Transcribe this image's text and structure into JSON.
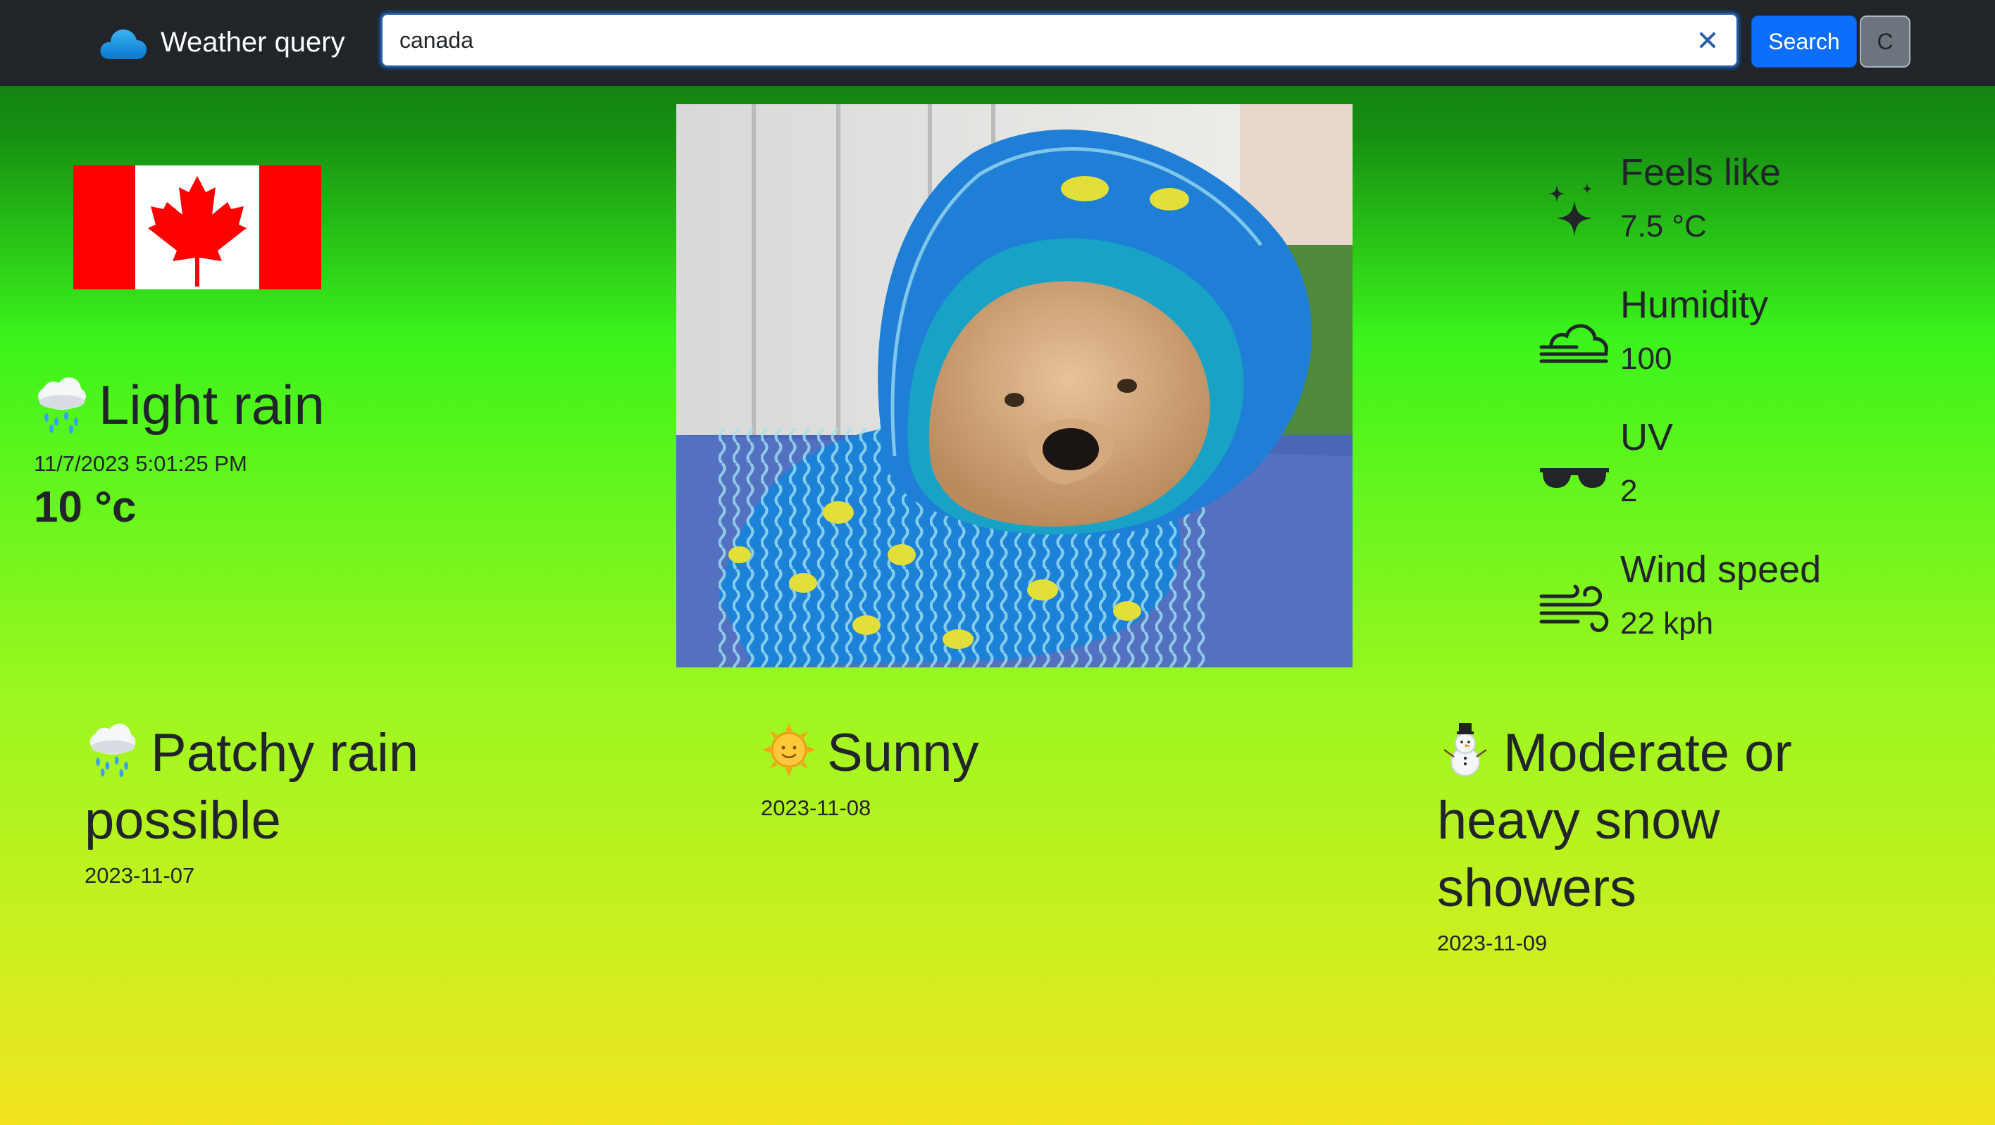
{
  "navbar": {
    "brand_text": "Weather query",
    "brand_icon": "cloud-icon",
    "search_value": "canada",
    "search_button_label": "Search",
    "unit_button_label": "C"
  },
  "current": {
    "flag": "canada-flag",
    "condition": "Light rain",
    "condition_icon": "rain-cloud-icon",
    "datetime": "11/7/2023 5:01:25 PM",
    "temperature": "10 °c"
  },
  "stats": [
    {
      "icon": "stars-icon",
      "label": "Feels like",
      "value": "7.5 °C"
    },
    {
      "icon": "cloud-wind-icon",
      "label": "Humidity",
      "value": "100"
    },
    {
      "icon": "sunglasses-icon",
      "label": "UV",
      "value": "2"
    },
    {
      "icon": "wind-icon",
      "label": "Wind speed",
      "value": "22 kph"
    }
  ],
  "forecast": [
    {
      "icon": "rain-cloud-icon",
      "condition": "Patchy rain possible",
      "date": "2023-11-07"
    },
    {
      "icon": "sun-icon",
      "condition": "Sunny",
      "date": "2023-11-08"
    },
    {
      "icon": "snowman-icon",
      "condition": "Moderate or heavy snow showers",
      "date": "2023-11-09"
    }
  ],
  "colors": {
    "navbar_bg": "#212529",
    "search_button": "#0d6efd",
    "unit_button": "#6c757d",
    "flag_red": "#ff0000",
    "gradient_top": "#0a6f0d",
    "gradient_mid": "#3bf41b",
    "gradient_bottom": "#f3e320"
  }
}
